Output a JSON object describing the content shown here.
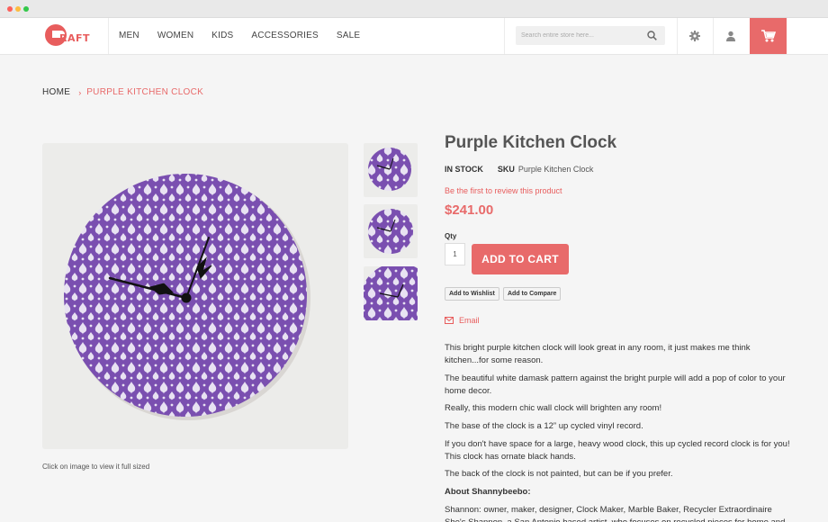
{
  "header": {
    "logo_text": "RAFT",
    "nav": [
      "MEN",
      "WOMEN",
      "KIDS",
      "ACCESSORIES",
      "SALE"
    ],
    "search_placeholder": "Search entire store here...",
    "icons": [
      "search-icon",
      "gear-icon",
      "user-icon",
      "cart-icon"
    ]
  },
  "breadcrumb": {
    "home": "HOME",
    "separator": "›",
    "current": "PURPLE KITCHEN CLOCK"
  },
  "gallery": {
    "caption": "Click on image to view it full sized",
    "thumb_count": 3
  },
  "product": {
    "title": "Purple Kitchen Clock",
    "stock": "IN STOCK",
    "sku_label": "SKU",
    "sku_value": "Purple Kitchen Clock",
    "review_link": "Be the first to review this product",
    "price": "$241.00",
    "qty_label": "Qty",
    "qty_value": "1",
    "add_to_cart": "ADD TO CART",
    "add_to_wishlist": "Add to Wishlist",
    "add_to_compare": "Add to Compare",
    "email": "Email"
  },
  "description": [
    "This bright purple kitchen clock will look great in any room, it just makes me think kitchen...for some reason.",
    "The beautiful white damask pattern against the bright purple will add a pop of color to your home decor.",
    "Really, this modern chic wall clock will brighten any room!",
    "The base of the clock is a 12” up cycled vinyl record.",
    "If you don't have space for a large, heavy wood clock, this up cycled record clock is for you! This clock has ornate black hands.",
    "The back of the clock is not painted, but can be if you prefer.",
    "About Shannybeebo:",
    "Shannon: owner, maker, designer, Clock Maker, Marble Baker, Recycler Extraordinaire She's Shannon, a San Antonio based artist, who focuses on recycled pieces for home and"
  ],
  "colors": {
    "accent": "#e86a6a",
    "clock_purple": "#7a4fb0"
  }
}
